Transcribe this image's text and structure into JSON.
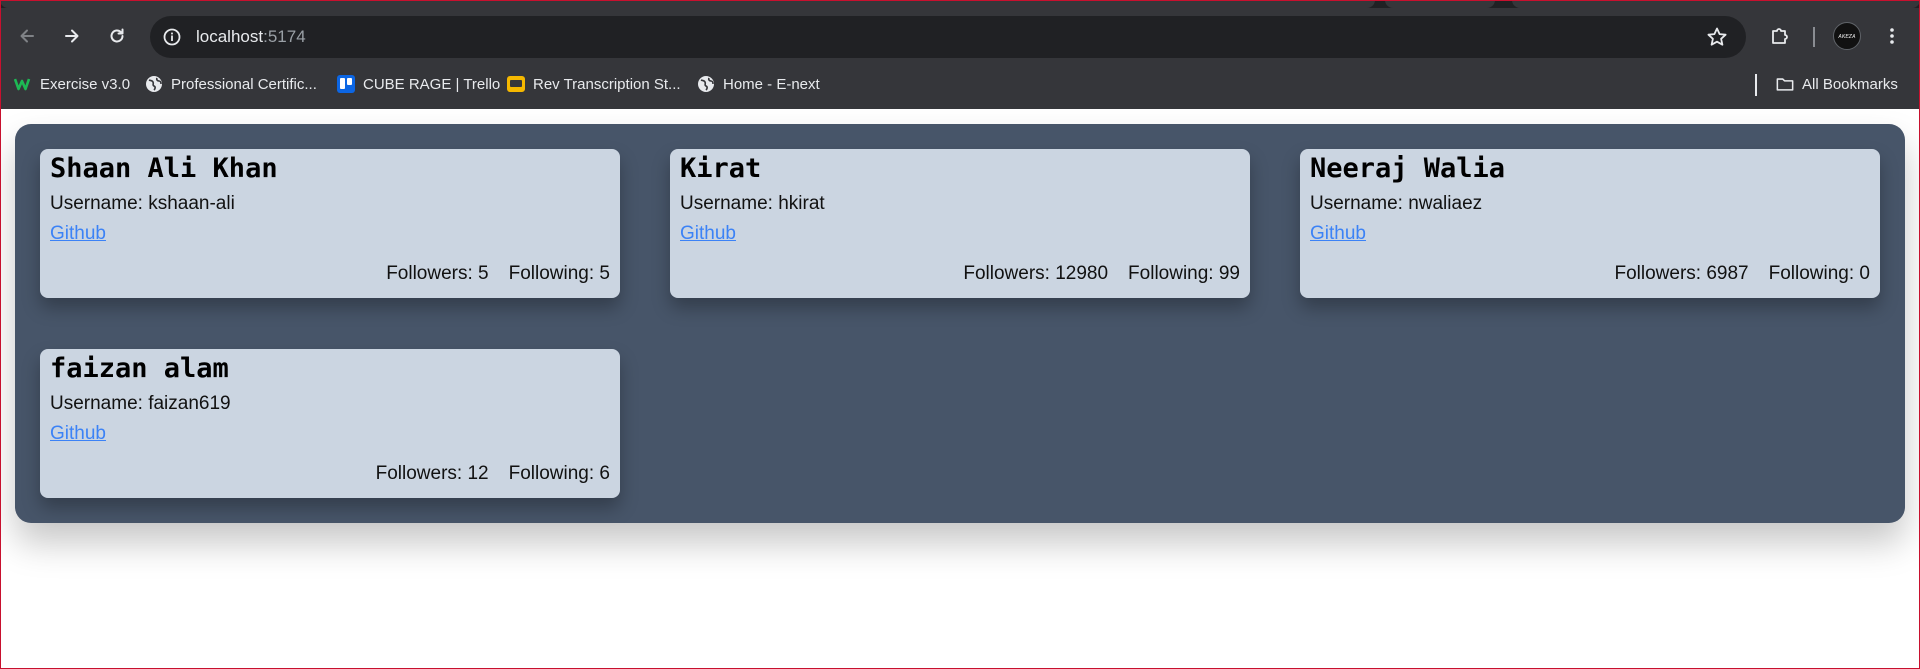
{
  "browser": {
    "url_host": "localhost",
    "url_port": ":5174",
    "avatar_text": "ᴀᴋᴇᴢᴀ"
  },
  "bookmarks": [
    {
      "label": "Exercise v3.0",
      "icon": "w-logo-icon"
    },
    {
      "label": "Professional Certific...",
      "icon": "globe-icon"
    },
    {
      "label": "CUBE RAGE | Trello",
      "icon": "trello-icon"
    },
    {
      "label": "Rev Transcription St...",
      "icon": "rev-icon"
    },
    {
      "label": "Home - E-next",
      "icon": "globe-icon"
    }
  ],
  "all_bookmarks_label": "All Bookmarks",
  "users": [
    {
      "name": "Shaan Ali Khan",
      "username_line": "Username: kshaan-ali",
      "link": "Github",
      "followers": "Followers: 5",
      "following": "Following: 5"
    },
    {
      "name": "Kirat",
      "username_line": "Username: hkirat",
      "link": "Github",
      "followers": "Followers: 12980",
      "following": "Following: 99"
    },
    {
      "name": "Neeraj Walia",
      "username_line": "Username: nwaliaez",
      "link": "Github",
      "followers": "Followers: 6987",
      "following": "Following: 0"
    },
    {
      "name": "faizan alam",
      "username_line": "Username: faizan619",
      "link": "Github",
      "followers": "Followers: 12",
      "following": "Following: 6"
    }
  ],
  "colors": {
    "panel": "#475569",
    "card": "#cbd5e1",
    "link": "#3b82f6",
    "chrome": "#35363a"
  }
}
